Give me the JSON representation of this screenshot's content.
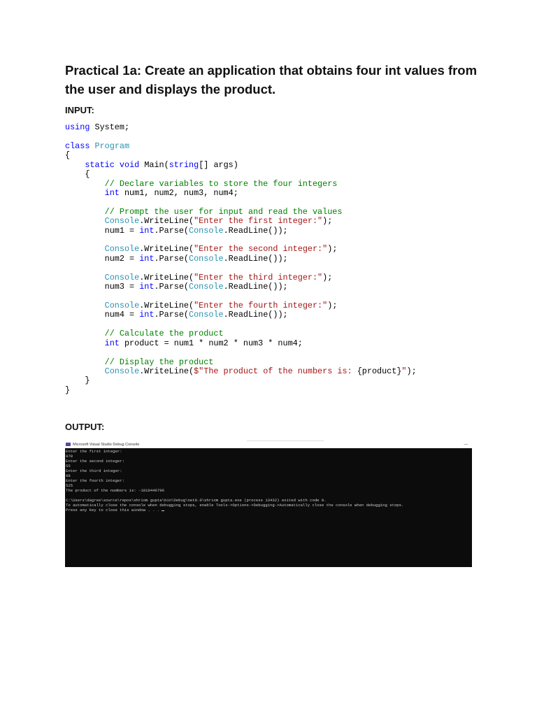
{
  "title": "Practical 1a: Create an application that obtains four int values from the user and displays the product.",
  "input_label": "INPUT:",
  "output_label": "OUTPUT:",
  "code_lines": [
    [
      [
        "using",
        "kw"
      ],
      [
        " System;",
        ""
      ]
    ],
    [],
    [
      [
        "class",
        "kw"
      ],
      [
        " ",
        ""
      ],
      [
        "Program",
        "ty"
      ]
    ],
    [
      [
        "{",
        ""
      ]
    ],
    [
      [
        "    ",
        ""
      ],
      [
        "static",
        "kw"
      ],
      [
        " ",
        ""
      ],
      [
        "void",
        "kw"
      ],
      [
        " Main(",
        ""
      ],
      [
        "string",
        "kw"
      ],
      [
        "[] args)",
        ""
      ]
    ],
    [
      [
        "    {",
        ""
      ]
    ],
    [
      [
        "        ",
        ""
      ],
      [
        "// Declare variables to store the four integers",
        "cm"
      ]
    ],
    [
      [
        "        ",
        ""
      ],
      [
        "int",
        "kw"
      ],
      [
        " num1, num2, num3, num4;",
        ""
      ]
    ],
    [],
    [
      [
        "        ",
        ""
      ],
      [
        "// Prompt the user for input and read the values",
        "cm"
      ]
    ],
    [
      [
        "        ",
        ""
      ],
      [
        "Console",
        "ty"
      ],
      [
        ".WriteLine(",
        ""
      ],
      [
        "\"Enter the first integer:\"",
        "st"
      ],
      [
        ");",
        ""
      ]
    ],
    [
      [
        "        num1 = ",
        ""
      ],
      [
        "int",
        "kw"
      ],
      [
        ".Parse(",
        ""
      ],
      [
        "Console",
        "ty"
      ],
      [
        ".ReadLine());",
        ""
      ]
    ],
    [],
    [
      [
        "        ",
        ""
      ],
      [
        "Console",
        "ty"
      ],
      [
        ".WriteLine(",
        ""
      ],
      [
        "\"Enter the second integer:\"",
        "st"
      ],
      [
        ");",
        ""
      ]
    ],
    [
      [
        "        num2 = ",
        ""
      ],
      [
        "int",
        "kw"
      ],
      [
        ".Parse(",
        ""
      ],
      [
        "Console",
        "ty"
      ],
      [
        ".ReadLine());",
        ""
      ]
    ],
    [],
    [
      [
        "        ",
        ""
      ],
      [
        "Console",
        "ty"
      ],
      [
        ".WriteLine(",
        ""
      ],
      [
        "\"Enter the third integer:\"",
        "st"
      ],
      [
        ");",
        ""
      ]
    ],
    [
      [
        "        num3 = ",
        ""
      ],
      [
        "int",
        "kw"
      ],
      [
        ".Parse(",
        ""
      ],
      [
        "Console",
        "ty"
      ],
      [
        ".ReadLine());",
        ""
      ]
    ],
    [],
    [
      [
        "        ",
        ""
      ],
      [
        "Console",
        "ty"
      ],
      [
        ".WriteLine(",
        ""
      ],
      [
        "\"Enter the fourth integer:\"",
        "st"
      ],
      [
        ");",
        ""
      ]
    ],
    [
      [
        "        num4 = ",
        ""
      ],
      [
        "int",
        "kw"
      ],
      [
        ".Parse(",
        ""
      ],
      [
        "Console",
        "ty"
      ],
      [
        ".ReadLine());",
        ""
      ]
    ],
    [],
    [
      [
        "        ",
        ""
      ],
      [
        "// Calculate the product",
        "cm"
      ]
    ],
    [
      [
        "        ",
        ""
      ],
      [
        "int",
        "kw"
      ],
      [
        " product = num1 * num2 * num3 * num4;",
        ""
      ]
    ],
    [],
    [
      [
        "        ",
        ""
      ],
      [
        "// Display the product",
        "cm"
      ]
    ],
    [
      [
        "        ",
        ""
      ],
      [
        "Console",
        "ty"
      ],
      [
        ".WriteLine(",
        ""
      ],
      [
        "$\"The product of the numbers is: ",
        "st"
      ],
      [
        "{product}",
        ""
      ],
      [
        "\"",
        "st"
      ],
      [
        ");",
        ""
      ]
    ],
    [
      [
        "    }",
        ""
      ]
    ],
    [
      [
        "}",
        ""
      ]
    ]
  ],
  "console": {
    "window_title": "Microsoft Visual Studio Debug Console",
    "minimize": "—",
    "lines": [
      "Enter the first integer:",
      "878",
      "Enter the second integer:",
      "55",
      "Enter the third integer:",
      "98",
      "Enter the fourth integer:",
      "525",
      "The product of the numbers is: -1810446796",
      "",
      "C:\\Users\\dagree\\source\\repos\\shriom gupta\\bin\\Debug\\net8.0\\shriom gupta.exe (process 13432) exited with code 0.",
      "To automatically close the console when debugging stops, enable Tools->Options->Debugging->Automatically close the console when debugging stops.",
      "Press any key to close this window . . ."
    ]
  },
  "colors": {
    "keyword": "#0000ff",
    "type": "#2b91af",
    "comment": "#008000",
    "string": "#a31515",
    "console_bg": "#0c0c0c"
  }
}
